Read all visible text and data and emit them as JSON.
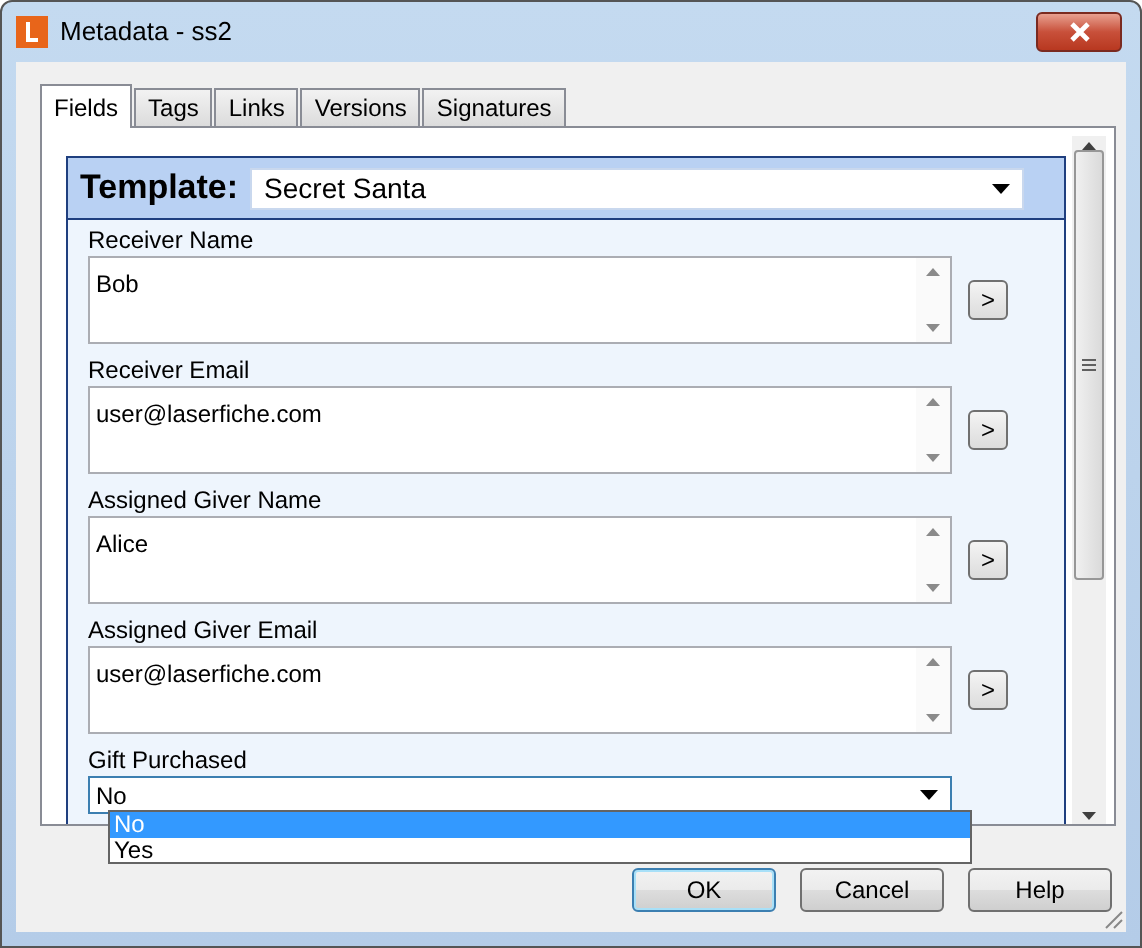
{
  "window": {
    "title": "Metadata - ss2"
  },
  "tabs": [
    {
      "label": "Fields",
      "selected": true
    },
    {
      "label": "Tags",
      "selected": false
    },
    {
      "label": "Links",
      "selected": false
    },
    {
      "label": "Versions",
      "selected": false
    },
    {
      "label": "Signatures",
      "selected": false
    }
  ],
  "template": {
    "label": "Template:",
    "value": "Secret Santa"
  },
  "fields": [
    {
      "kind": "text",
      "label": "Receiver Name",
      "value": "Bob",
      "button": ">"
    },
    {
      "kind": "text",
      "label": "Receiver Email",
      "value": "user@laserfiche.com",
      "button": ">"
    },
    {
      "kind": "text",
      "label": "Assigned Giver Name",
      "value": "Alice",
      "button": ">"
    },
    {
      "kind": "text",
      "label": "Assigned Giver Email",
      "value": "user@laserfiche.com",
      "button": ">"
    },
    {
      "kind": "dropdown",
      "label": "Gift Purchased",
      "value": "No",
      "options": [
        {
          "label": "No",
          "selected": true
        },
        {
          "label": "Yes",
          "selected": false
        }
      ]
    }
  ],
  "buttons": [
    {
      "label": "OK",
      "default": true
    },
    {
      "label": "Cancel",
      "default": false
    },
    {
      "label": "Help",
      "default": false
    }
  ]
}
